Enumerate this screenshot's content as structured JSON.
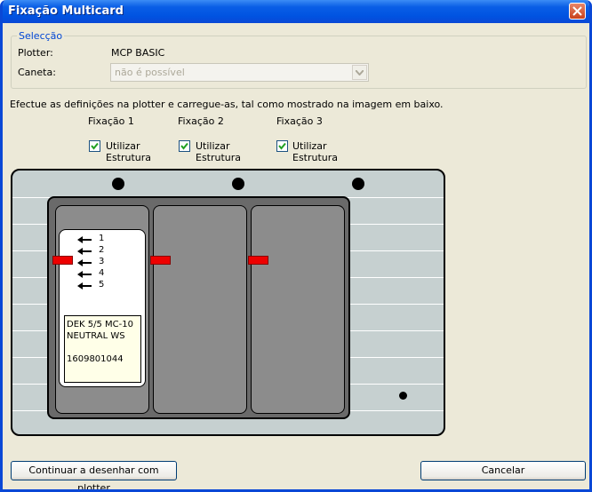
{
  "window": {
    "title": "Fixação Multicard"
  },
  "selection": {
    "legend": "Selecção",
    "plotter_label": "Plotter:",
    "plotter_value": "MCP BASIC",
    "pen_label": "Caneta:",
    "pen_value": "não é possível"
  },
  "instructions": "Efectue as definições na plotter e carregue-as, tal como mostrado na imagem em baixo.",
  "fixations": [
    {
      "title": "Fixação 1",
      "checked": true,
      "option_line1": "Utilizar",
      "option_line2": "Estrutura"
    },
    {
      "title": "Fixação 2",
      "checked": true,
      "option_line1": "Utilizar",
      "option_line2": "Estrutura"
    },
    {
      "title": "Fixação 3",
      "checked": true,
      "option_line1": "Utilizar",
      "option_line2": "Estrutura"
    }
  ],
  "card": {
    "positions": [
      "1",
      "2",
      "3",
      "4",
      "5"
    ],
    "label_line1": "DEK 5/5 MC-10",
    "label_line2": "NEUTRAL WS",
    "label_line3": "1609801044"
  },
  "buttons": {
    "continue": "Continuar a desenhar com plotter",
    "cancel": "Cancelar"
  },
  "colors": {
    "marker": "#ee0000",
    "titlebar": "#0053e1",
    "plotter_body": "#c6d0d0"
  }
}
